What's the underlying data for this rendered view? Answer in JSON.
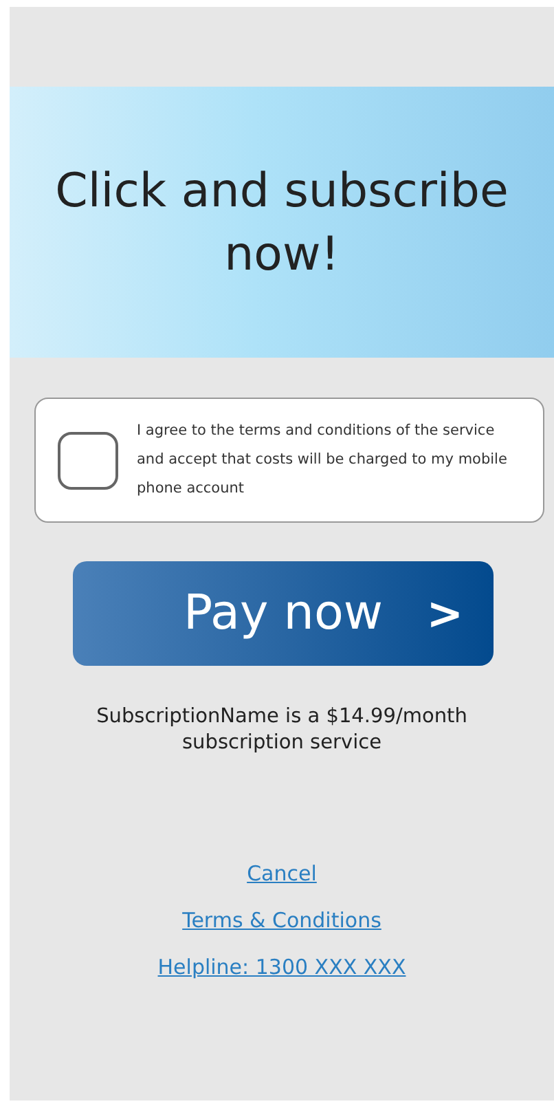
{
  "banner": {
    "title": "Click and subscribe now!"
  },
  "agreement": {
    "checked": false,
    "text": "I agree to the terms and conditions of the service and accept that costs will be charged to my mobile phone account"
  },
  "pay_button": {
    "label": "Pay now",
    "icon": ">"
  },
  "price_note": "SubscriptionName is a $14.99/month subscription service",
  "links": [
    "Cancel",
    "Terms & Conditions",
    "Helpline: 1300 XXX XXX"
  ]
}
